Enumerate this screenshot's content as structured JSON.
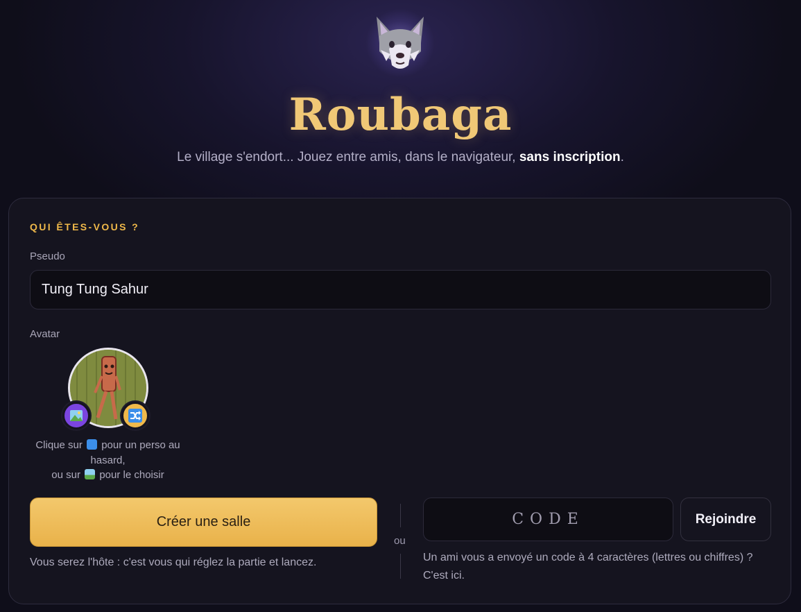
{
  "hero": {
    "logo_icon": "wolf-face-icon",
    "title": "Roubaga",
    "subtitle_pre": "Le village s'endort... Jouez entre amis, dans le navigateur, ",
    "subtitle_bold": "sans inscription",
    "subtitle_post": "."
  },
  "profile": {
    "section_title": "QUI ÊTES-VOUS ?",
    "pseudo_label": "Pseudo",
    "pseudo_value": "Tung Tung Sahur",
    "avatar_label": "Avatar",
    "hint_line1_pre": "Clique sur",
    "hint_line1_post": "pour un perso au hasard,",
    "hint_line2_pre": "ou sur",
    "hint_line2_post": "pour le choisir",
    "random_icon": "shuffle-icon",
    "pick_icon": "picture-icon"
  },
  "actions": {
    "create_label": "Créer une salle",
    "host_note": "Vous serez l'hôte : c'est vous qui réglez la partie et lancez.",
    "or_label": "ou",
    "code_placeholder": "CODE",
    "join_label": "Rejoindre",
    "join_note": "Un ami vous a envoyé un code à 4 caractères (lettres ou chiffres) ? C'est ici."
  },
  "colors": {
    "accent": "#f0b94a",
    "title": "#f0c876",
    "card_bg": "#15141f",
    "page_bg": "#0f0e1a"
  }
}
